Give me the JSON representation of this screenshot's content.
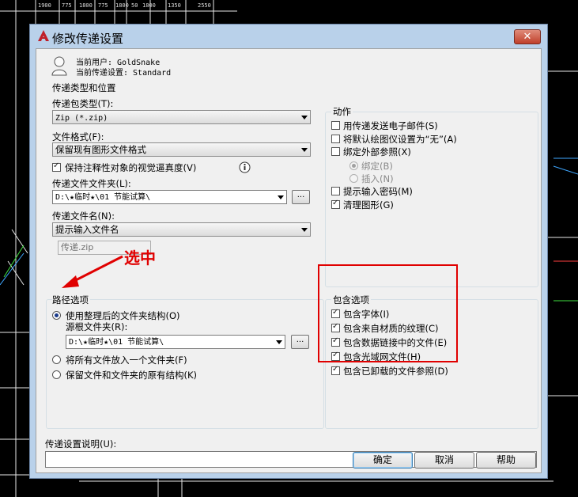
{
  "cad_ruler_labels": [
    "1900",
    "775",
    "1800",
    "775",
    "1800",
    "50",
    "1800",
    "1350",
    "2550"
  ],
  "dialog": {
    "title": "修改传递设置",
    "close_label": "✕",
    "current_user_label": "当前用户: GoldSnake",
    "current_setting_label": "当前传递设置: Standard",
    "type_group": {
      "title": "传递类型和位置",
      "package_type_label": "传递包类型(T):",
      "package_type_value": "Zip (*.zip)",
      "file_format_label": "文件格式(F):",
      "file_format_value": "保留现有图形文件格式",
      "keep_visual_label": "保持注释性对象的视觉逼真度(V)",
      "folder_label": "传递文件文件夹(L):",
      "folder_value": "D:\\★临时★\\01 节能试算\\",
      "browse_label": "...",
      "filename_label": "传递文件名(N):",
      "filename_value": "提示输入文件名",
      "filename_preview": "传递.zip"
    },
    "path_group": {
      "title": "路径选项",
      "use_organized_label": "使用整理后的文件夹结构(O)",
      "source_root_label": "源根文件夹(R):",
      "source_root_value": "D:\\★临时★\\01 节能试算\\",
      "browse_label": "...",
      "put_all_label": "将所有文件放入一个文件夹(F)",
      "keep_structure_label": "保留文件和文件夹的原有结构(K)"
    },
    "actions_group": {
      "title": "动作",
      "email_label": "用传递发送电子邮件(S)",
      "plotter_label": "将默认绘图仪设置为“无”(A)",
      "bind_xref_label": "绑定外部参照(X)",
      "bind_label": "绑定(B)",
      "insert_label": "插入(N)",
      "password_label": "提示输入密码(M)",
      "purge_label": "清理图形(G)"
    },
    "include_group": {
      "title": "包含选项",
      "fonts_label": "包含字体(I)",
      "textures_label": "包含来自材质的纹理(C)",
      "datalinks_label": "包含数据链接中的文件(E)",
      "photometric_label": "包含光域网文件(H)",
      "unloaded_label": "包含已卸载的文件参照(D)"
    },
    "description_label": "传递设置说明(U):",
    "ok_label": "确定",
    "cancel_label": "取消",
    "help_label": "帮助"
  },
  "annotation": {
    "text": "选中",
    "color": "#e00000"
  },
  "colors": {
    "dialog_frame": "#b9d1ea",
    "client_bg": "#f0f0f0",
    "highlight_box": "#e00000"
  }
}
